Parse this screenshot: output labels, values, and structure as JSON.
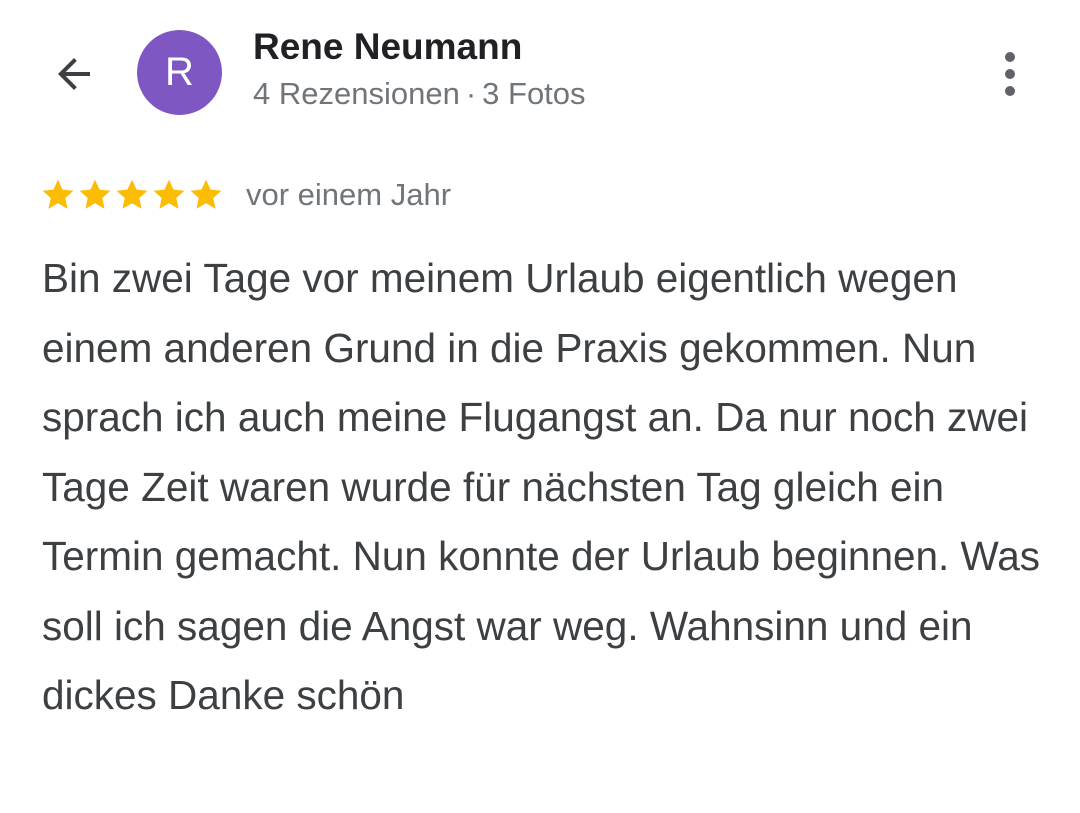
{
  "header": {
    "back_icon": "arrow-back-icon",
    "avatar_letter": "R",
    "avatar_color": "#7e57c2",
    "user_name": "Rene Neumann",
    "reviews_count": "4 Rezensionen",
    "separator": "·",
    "photos_count": "3 Fotos",
    "more_icon": "more-vert-icon"
  },
  "review": {
    "rating": 5,
    "max_rating": 5,
    "star_color": "#fbbc04",
    "time_ago": "vor einem Jahr",
    "text": "Bin zwei Tage vor meinem Urlaub eigentlich wegen einem anderen Grund in die Praxis gekommen. Nun sprach ich auch meine Flugangst an. Da nur noch zwei Tage Zeit waren wurde für nächsten Tag gleich ein Termin gemacht. Nun konnte der Urlaub beginnen. Was soll ich sagen die Angst war weg. Wahnsinn und ein dickes Danke schön"
  }
}
